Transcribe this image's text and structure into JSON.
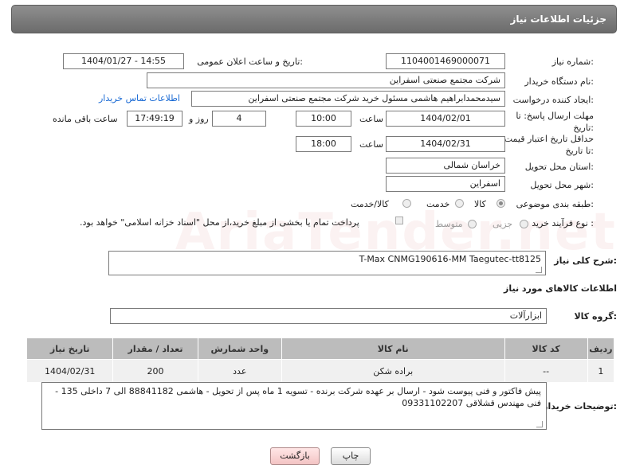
{
  "header": {
    "title": "جزئیات اطلاعات نیاز"
  },
  "form": {
    "need_number": {
      "label": "شماره نیاز:",
      "value": "1104001469000071"
    },
    "announce": {
      "label": "تاریخ و ساعت اعلان عمومی:",
      "value": "1404/01/27 - 14:55"
    },
    "buyer_org": {
      "label": "نام دستگاه خریدار:",
      "value": "شرکت مجتمع صنعتی اسفراین"
    },
    "creator": {
      "label": "ایجاد کننده درخواست:",
      "value": "سیدمحمدابراهیم هاشمی مسئول خرید شرکت مجتمع صنعتی اسفراین",
      "contact_link": "اطلاعات تماس خریدار"
    },
    "reply_deadline": {
      "label": "مهلت ارسال پاسخ: تا تاریخ:",
      "date": "1404/02/01",
      "time_label": "ساعت",
      "time": "10:00",
      "days": "4",
      "days_label": "روز و",
      "remaining": "17:49:19",
      "remaining_label": "ساعت باقی مانده"
    },
    "price_validity": {
      "label": "حداقل تاریخ اعتبار قیمت: تا تاریخ:",
      "date": "1404/02/31",
      "time_label": "ساعت",
      "time": "18:00"
    },
    "province": {
      "label": "استان محل تحویل:",
      "value": "خراسان شمالی"
    },
    "city": {
      "label": "شهر محل تحویل:",
      "value": "اسفراین"
    },
    "category": {
      "label": "طبقه بندی موضوعی:",
      "options": [
        "کالا",
        "خدمت",
        "کالا/خدمت"
      ],
      "selected": "کالا"
    },
    "purchase_type": {
      "label": "نوع فرآیند خرید :",
      "options": [
        "جزیی",
        "متوسط"
      ],
      "payment_note": "پرداخت تمام یا بخشی از مبلغ خرید،از محل \"اسناد خزانه اسلامی\" خواهد بود."
    }
  },
  "description": {
    "label": "شرح کلی نیاز:",
    "value": "T-Max CNMG190616-MM Taegutec-tt8125"
  },
  "items_section": {
    "title": "اطلاعات کالاهای مورد نیاز",
    "group_label": "گروه کالا:",
    "group_value": "ابزارآلات"
  },
  "table": {
    "headers": [
      "ردیف",
      "کد کالا",
      "نام کالا",
      "واحد شمارش",
      "تعداد / مقدار",
      "تاریخ نیاز"
    ],
    "rows": [
      [
        "1",
        "--",
        "براده شکن",
        "عدد",
        "200",
        "1404/02/31"
      ]
    ]
  },
  "buyer_notes": {
    "label": "توضیحات خریدار:",
    "value": "پیش فاکتور و فنی پیوست شود - ارسال بر عهده شرکت برنده - تسویه 1 ماه پس از تحویل - هاشمی 88841182 الی 7 داخلی 135 - فنی مهندس قشلاقی 09331102207"
  },
  "buttons": {
    "print": "چاپ",
    "back": "بازگشت"
  },
  "watermark": "AriaTender.net",
  "colors": {
    "header_bg": "#7a7a7a",
    "link": "#1a6ad4",
    "table_header": "#bcbcbc",
    "back_button": "#f3c4c4"
  }
}
